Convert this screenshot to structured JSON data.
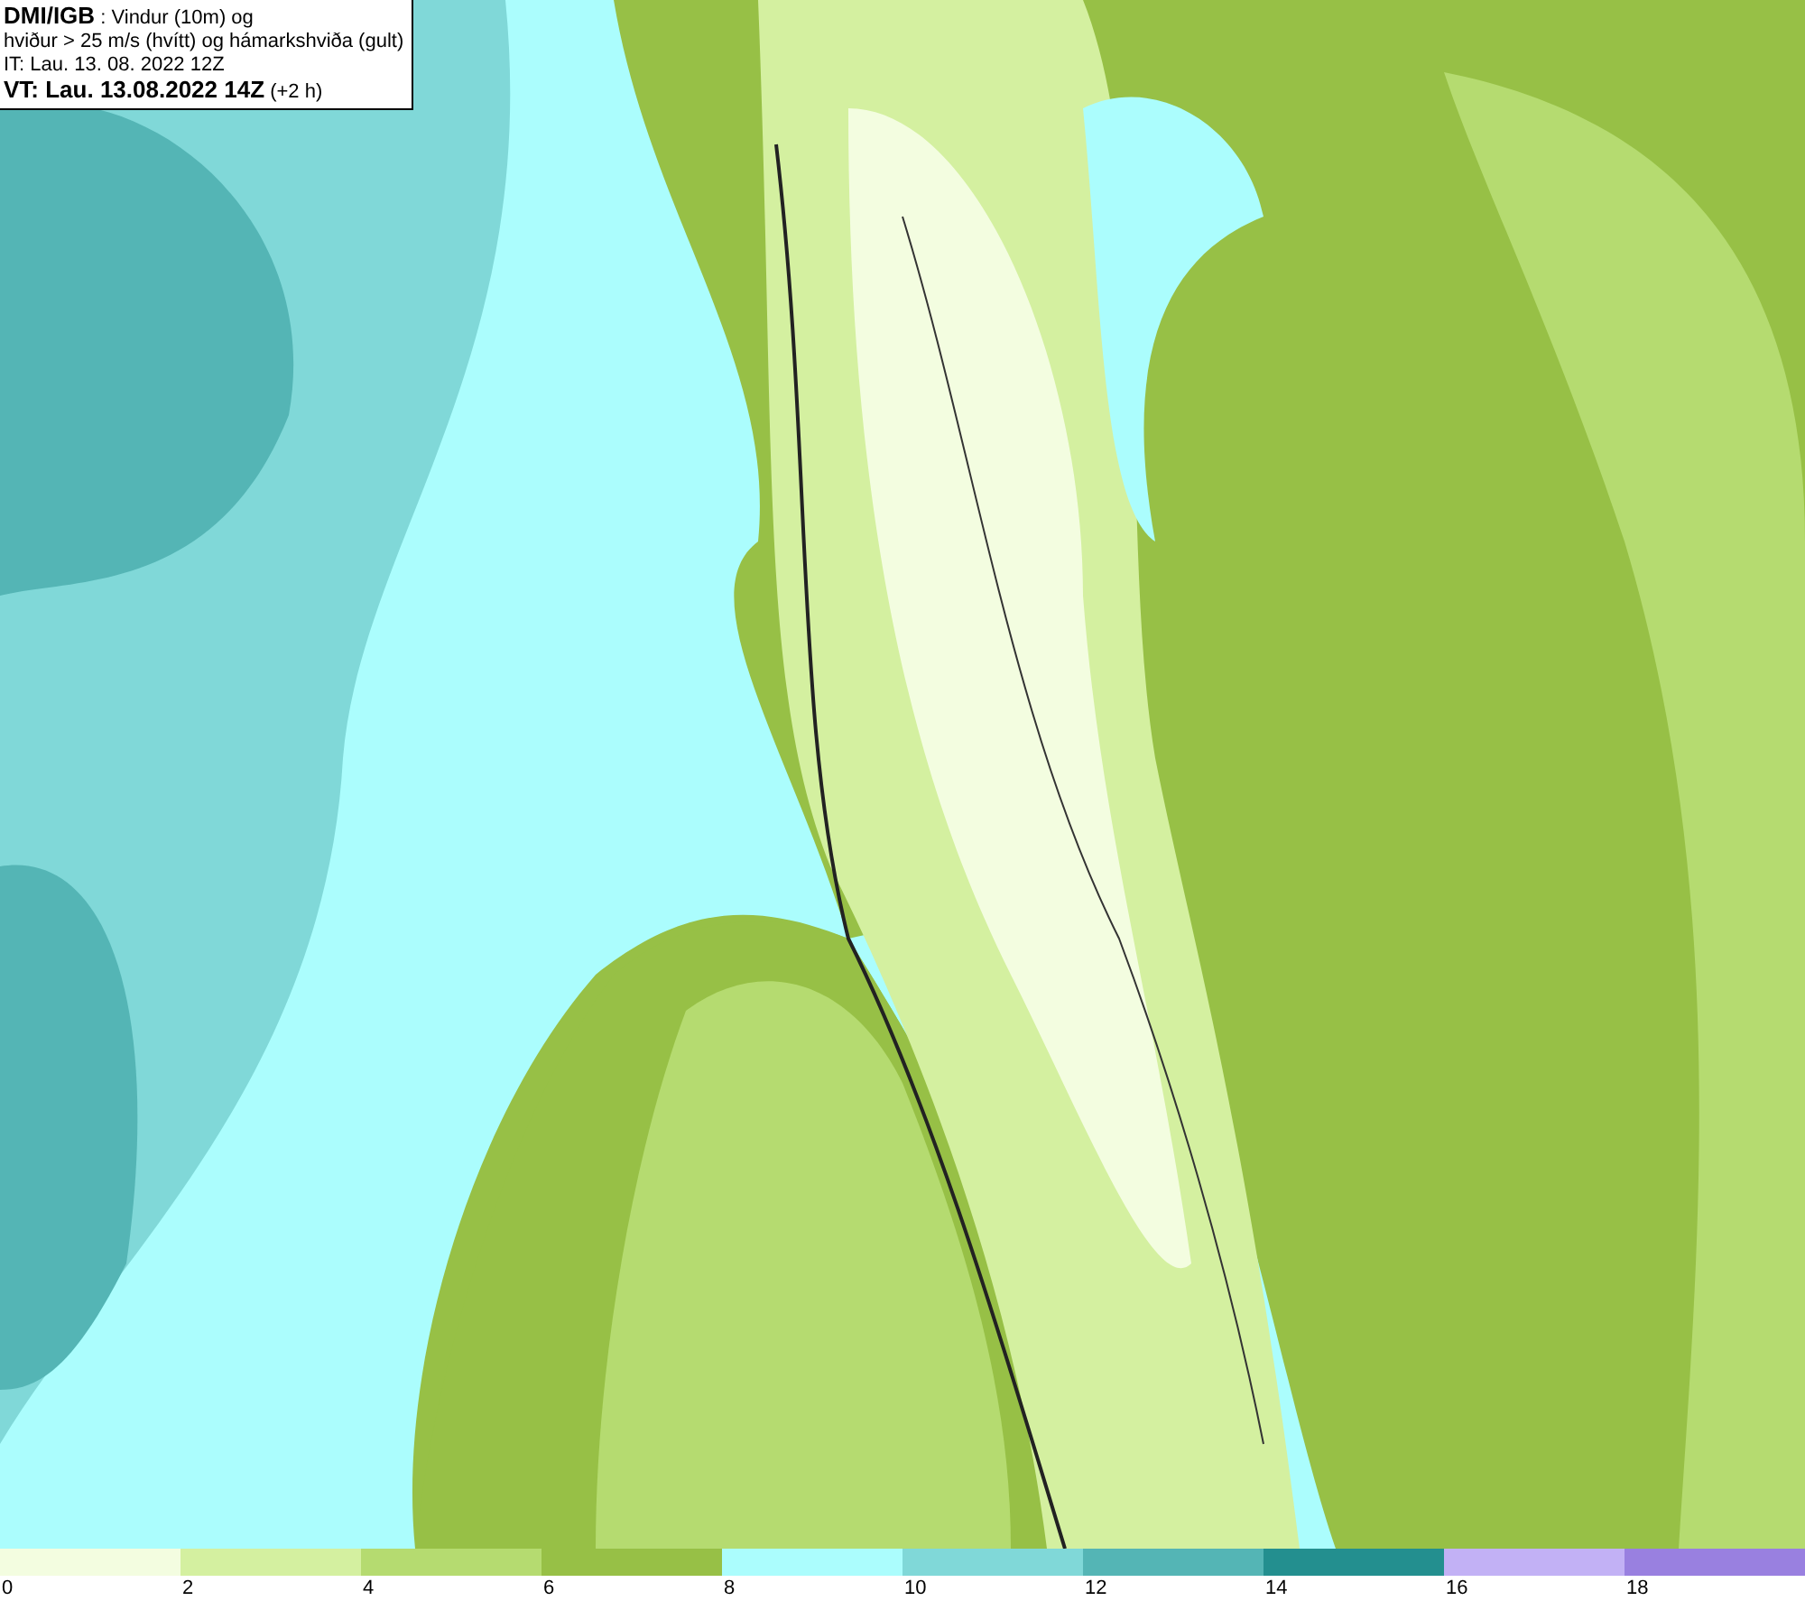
{
  "header": {
    "lines": [
      "**DMI/IGB** : Vindur (10m) og",
      "hviður > 25 m/s (hvítt) og hámarkshviða (gult)",
      "IT: Lau. 13. 08. 2022 12Z",
      "**VT: Lau. 13.08.2022 14Z** (+2 h)"
    ]
  },
  "legend": [
    {
      "label": "0",
      "color": "#f3fde0"
    },
    {
      "label": "2",
      "color": "#d4f0a0"
    },
    {
      "label": "4",
      "color": "#b5db70"
    },
    {
      "label": "6",
      "color": "#97c046"
    },
    {
      "label": "8",
      "color": "#abfdfd"
    },
    {
      "label": "10",
      "color": "#80d8d8"
    },
    {
      "label": "12",
      "color": "#54b5b5"
    },
    {
      "label": "14",
      "color": "#238f8f"
    },
    {
      "label": "16",
      "color": "#c2b1f5"
    },
    {
      "label": "18",
      "color": "#9980e0"
    }
  ]
}
